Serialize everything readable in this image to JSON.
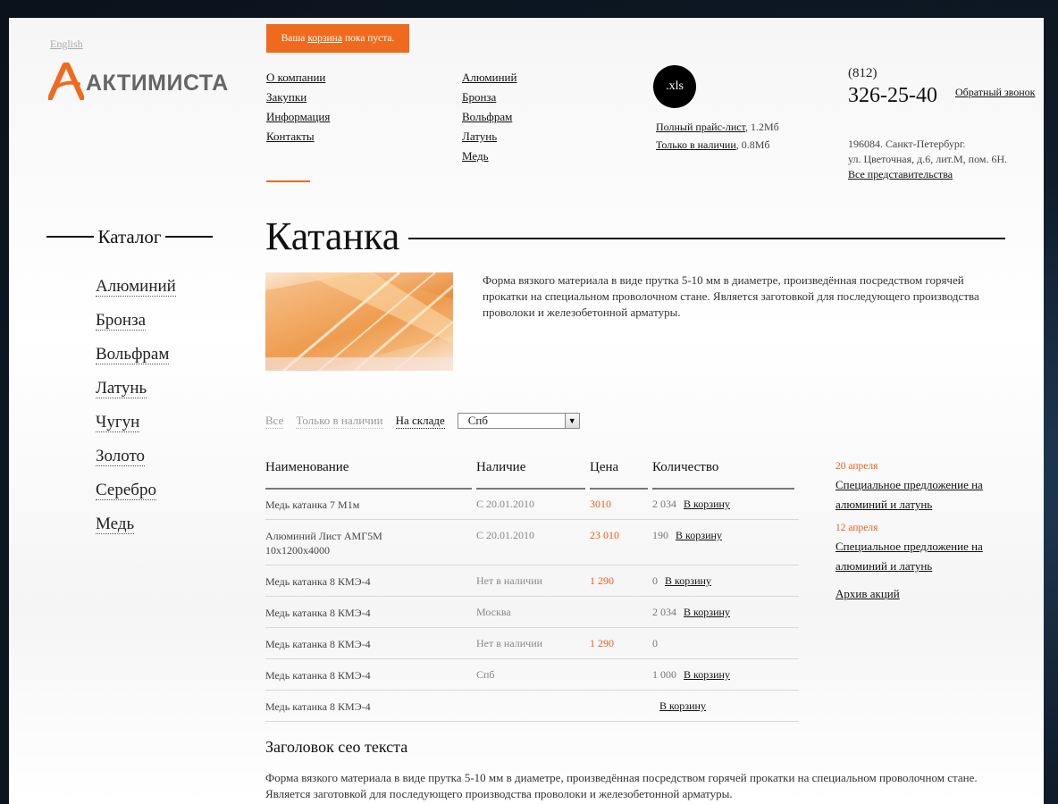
{
  "header": {
    "lang_link": "English",
    "logo_text": "АКТИМИСТА",
    "cart": {
      "prefix": "Ваша",
      "link": "корзина",
      "suffix": "пока пуста."
    },
    "nav_col1": [
      "О компании",
      "Закупки",
      "Информация",
      "Контакты"
    ],
    "nav_col2": [
      "Алюминий",
      "Бронза",
      "Вольфрам",
      "Латунь",
      "Медь"
    ],
    "xls_label": ".xls",
    "price_full": {
      "link": "Полный прайс-лист",
      "size": ", 1.2Мб"
    },
    "price_stock": {
      "link": "Только в наличии",
      "size": ", 0.8Мб"
    },
    "phone_code": "(812)",
    "phone_number": "326-25-40",
    "callback": "Обратный звонок",
    "address_line1": "196084. Санкт-Петербург.",
    "address_line2": "ул. Цветочная, д.6, лит.М, пом. 6Н.",
    "address_link": "Все представительства"
  },
  "sidebar": {
    "catalog_title": "Каталог",
    "items": [
      "Алюминий",
      "Бронза",
      "Вольфрам",
      "Латунь",
      "Чугун",
      "Золото",
      "Серебро",
      "Медь"
    ]
  },
  "main": {
    "title": "Катанка",
    "description": "Форма вязкого материала в виде прутка 5-10 мм в диаметре, произведённая посредством горячей прокатки на специальном проволочном стане. Является заготовкой для последующего производства проволоки и железобетонной арматуры.",
    "filters": {
      "all": "Все",
      "in_stock": "Только в наличии",
      "warehouse": "На складе",
      "city": "Спб"
    },
    "table": {
      "headers": [
        "Наименование",
        "Наличие",
        "Цена",
        "Количество"
      ],
      "cart_label": "В корзину",
      "rows": [
        {
          "name": "Медь катанка 7 М1м",
          "availability": "С 20.01.2010",
          "price": "3010",
          "qty": "2 034",
          "cart": true
        },
        {
          "name": "Алюминий Лист АМГ5М 10х1200х4000",
          "availability": "С 20.01.2010",
          "price": "23 010",
          "qty": "190",
          "cart": true
        },
        {
          "name": "Медь катанка 8 КМЭ-4",
          "availability": "Нет в наличии",
          "price": "1 290",
          "qty": "0",
          "cart": true
        },
        {
          "name": "Медь катанка 8 КМЭ-4",
          "availability": "Москва",
          "price": "",
          "qty": "2 034",
          "cart": true
        },
        {
          "name": "Медь катанка 8 КМЭ-4",
          "availability": "Нет в наличии",
          "price": "1 290",
          "qty": "0",
          "cart": false
        },
        {
          "name": "Медь катанка 8 КМЭ-4",
          "availability": "Спб",
          "price": "",
          "qty": "1 000",
          "cart": true
        },
        {
          "name": "Медь катанка 8 КМЭ-4",
          "availability": "",
          "price": "",
          "qty": "",
          "cart": true
        }
      ]
    },
    "seo_title": "Заголовок сео текста",
    "seo_text": "Форма вязкого материала в виде прутка 5-10 мм в диаметре, произведённая посредством горячей прокатки на специальном проволочном стане. Является заготовкой для последующего производства проволоки и железобетонной арматуры."
  },
  "promos": {
    "items": [
      {
        "date": "20 апреля",
        "text": "Специальное предложение на алюминий и латунь"
      },
      {
        "date": "12 апреля",
        "text": "Специальное предложение на алюминий и латунь"
      }
    ],
    "archive": "Архив акций"
  },
  "colors": {
    "accent": "#f06a1e",
    "price": "#e8601c",
    "frame": "#0e1a26"
  },
  "icons": {
    "xls": "xls-file-icon",
    "select_arrow": "chevron-down-icon",
    "logo": "logo-mark-icon"
  }
}
